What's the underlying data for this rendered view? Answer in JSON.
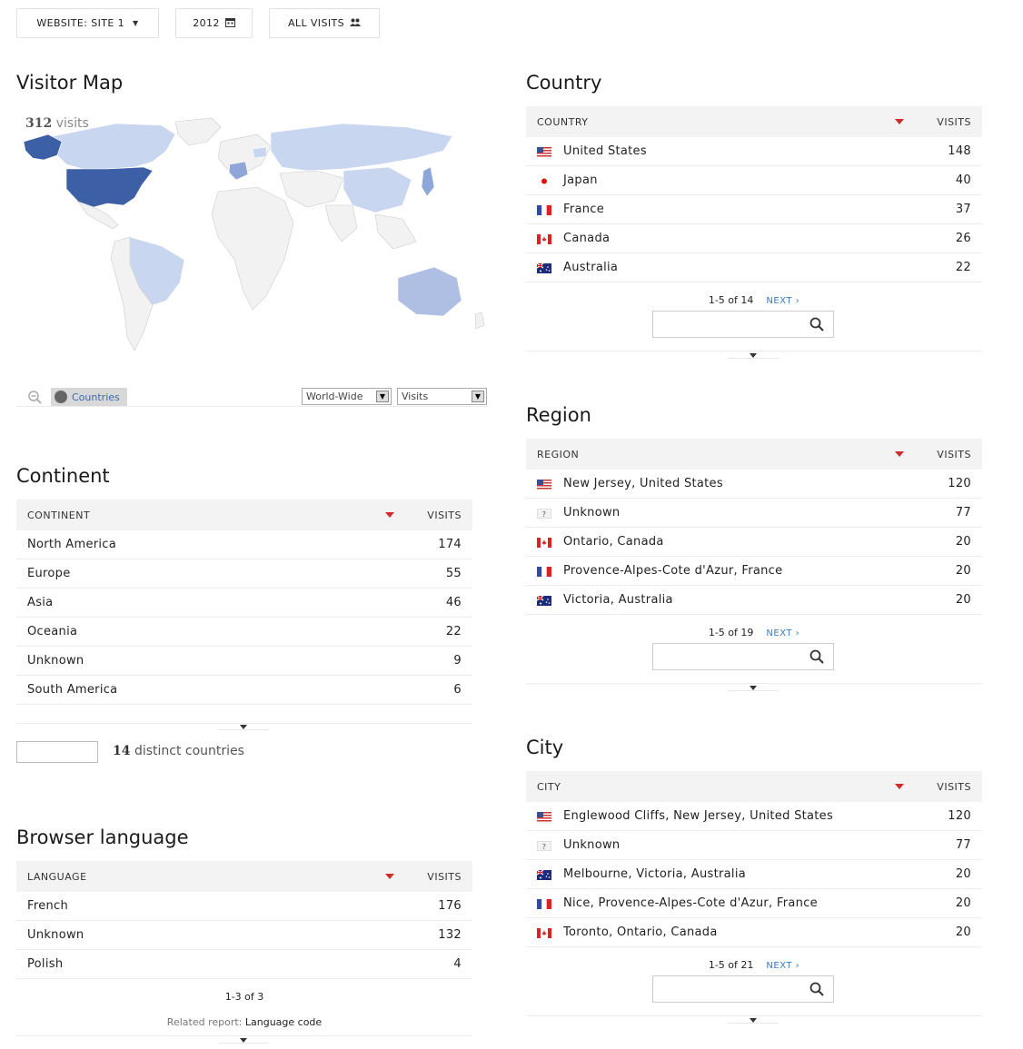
{
  "topbar": {
    "website_label": "WEBSITE: SITE 1",
    "date_label": "2012",
    "segment_label": "ALL VISITS"
  },
  "visitor_map": {
    "title": "Visitor Map",
    "visits_count": "312",
    "visits_word": "visits",
    "countries_button": "Countries",
    "region_select": "World-Wide",
    "metric_select": "Visits",
    "colors": {
      "high": "#3d5fa6",
      "mid": "#8ea6d8",
      "low": "#c9d6ef",
      "none": "#f2f2f2"
    }
  },
  "continent": {
    "title": "Continent",
    "col1": "CONTINENT",
    "col2": "VISITS",
    "rows": [
      {
        "label": "North America",
        "value": "174"
      },
      {
        "label": "Europe",
        "value": "55"
      },
      {
        "label": "Asia",
        "value": "46"
      },
      {
        "label": "Oceania",
        "value": "22"
      },
      {
        "label": "Unknown",
        "value": "9"
      },
      {
        "label": "South America",
        "value": "6"
      }
    ],
    "distinct_count": "14",
    "distinct_text": "distinct countries"
  },
  "language": {
    "title": "Browser language",
    "col1": "LANGUAGE",
    "col2": "VISITS",
    "rows": [
      {
        "label": "French",
        "value": "176"
      },
      {
        "label": "Unknown",
        "value": "132"
      },
      {
        "label": "Polish",
        "value": "4"
      }
    ],
    "pager": "1-3 of 3",
    "related_prefix": "Related report:",
    "related_link": "Language code"
  },
  "country": {
    "title": "Country",
    "col1": "COUNTRY",
    "col2": "VISITS",
    "rows": [
      {
        "label": "United States",
        "value": "148",
        "flag": "us-flag-icon"
      },
      {
        "label": "Japan",
        "value": "40",
        "flag": "jp-flag-icon"
      },
      {
        "label": "France",
        "value": "37",
        "flag": "fr-flag-icon"
      },
      {
        "label": "Canada",
        "value": "26",
        "flag": "ca-flag-icon"
      },
      {
        "label": "Australia",
        "value": "22",
        "flag": "au-flag-icon"
      }
    ],
    "pager": "1-5 of 14",
    "next": "NEXT ›"
  },
  "region": {
    "title": "Region",
    "col1": "REGION",
    "col2": "VISITS",
    "rows": [
      {
        "label": "New Jersey, United States",
        "value": "120",
        "flag": "us-flag-icon"
      },
      {
        "label": "Unknown",
        "value": "77",
        "flag": "unknown-flag-icon",
        "flag_text": "?"
      },
      {
        "label": "Ontario, Canada",
        "value": "20",
        "flag": "ca-flag-icon"
      },
      {
        "label": "Provence-Alpes-Cote d'Azur, France",
        "value": "20",
        "flag": "fr-flag-icon"
      },
      {
        "label": "Victoria, Australia",
        "value": "20",
        "flag": "au-flag-icon"
      }
    ],
    "pager": "1-5 of 19",
    "next": "NEXT ›"
  },
  "city": {
    "title": "City",
    "col1": "CITY",
    "col2": "VISITS",
    "rows": [
      {
        "label": "Englewood Cliffs, New Jersey, United States",
        "value": "120",
        "flag": "us-flag-icon"
      },
      {
        "label": "Unknown",
        "value": "77",
        "flag": "unknown-flag-icon",
        "flag_text": "?"
      },
      {
        "label": "Melbourne, Victoria, Australia",
        "value": "20",
        "flag": "au-flag-icon"
      },
      {
        "label": "Nice, Provence-Alpes-Cote d'Azur, France",
        "value": "20",
        "flag": "fr-flag-icon"
      },
      {
        "label": "Toronto, Ontario, Canada",
        "value": "20",
        "flag": "ca-flag-icon"
      }
    ],
    "pager": "1-5 of 21",
    "next": "NEXT ›"
  }
}
